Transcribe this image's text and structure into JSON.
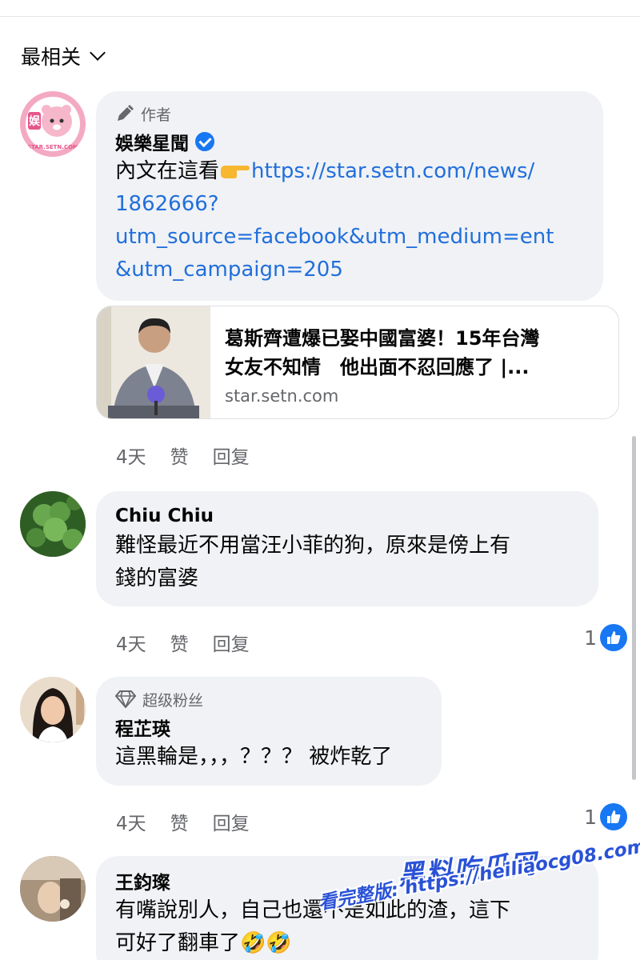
{
  "sort": {
    "label": "最相关"
  },
  "comments": [
    {
      "badge": "作者",
      "name": "娛樂星聞",
      "verified": true,
      "text_prefix": "內文在這看",
      "link_text": "https://star.setn.com/news/1862666?utm_source=facebook&utm_medium=ent&utm_campaign=205",
      "link_lines": [
        "https://star.setn.com/news/",
        "1862666?",
        "utm_source=facebook&utm_medium=ent",
        "&utm_campaign=205"
      ],
      "avatar_logo": "STAR.SETN.COM",
      "preview": {
        "title": "葛斯齊遭爆已娶中國富婆！15年台灣女友不知情　他出面不忍回應了 |...",
        "title_lines": [
          "葛斯齊遭爆已娶中國富婆！15年台灣",
          "女友不知情　他出面不忍回應了 |..."
        ],
        "domain": "star.setn.com"
      },
      "time": "4天",
      "like": "赞",
      "reply": "回复"
    },
    {
      "name": "Chiu Chiu",
      "text_lines": [
        "難怪最近不用當汪小菲的狗，原來是傍上有",
        "錢的富婆"
      ],
      "time": "4天",
      "like": "赞",
      "reply": "回复",
      "reactions": "1"
    },
    {
      "badge": "超级粉丝",
      "name": "程芷瑛",
      "text_lines": [
        "這黑輪是，，，？？？ 被炸乾了"
      ],
      "time": "4天",
      "like": "赞",
      "reply": "回复",
      "reactions": "1"
    },
    {
      "name": "王鈞璨",
      "text_lines": [
        "有嘴說別人，自己也還不是如此的渣，這下",
        "可好了翻車了🤣🤣"
      ]
    }
  ],
  "watermark": {
    "title": "黑料吃瓜网",
    "line": "看完整版: https://heiliaocg08.com"
  },
  "colors": {
    "link": "#216fdb",
    "like_blue": "#1877f2",
    "bubble": "#f0f2f5",
    "secondary_text": "#65676b"
  }
}
